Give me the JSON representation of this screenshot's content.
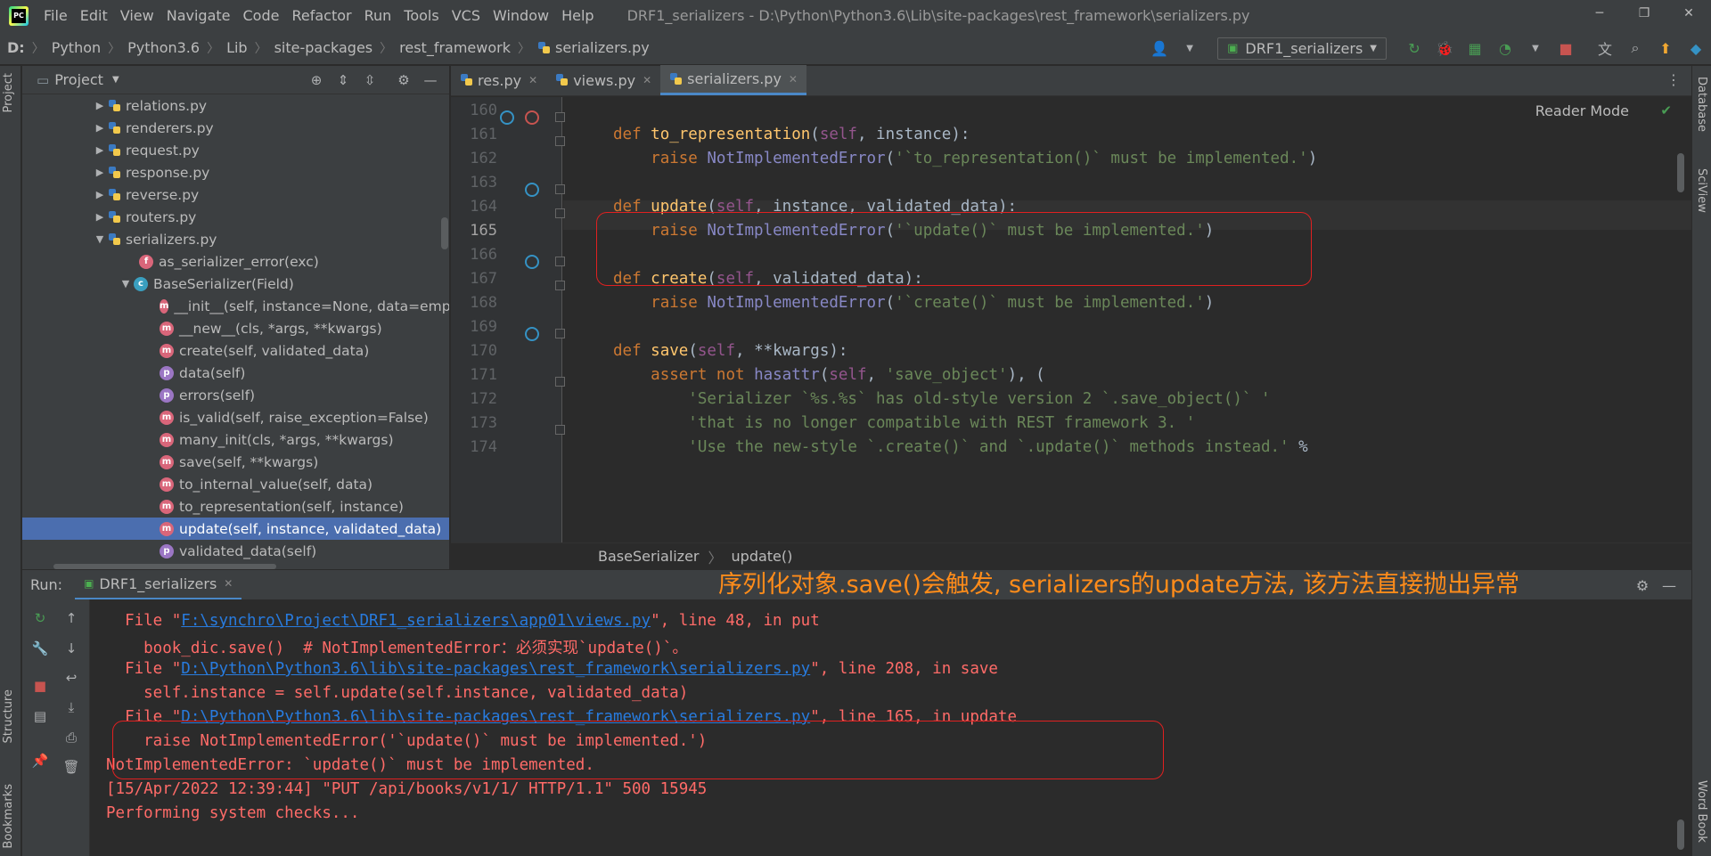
{
  "titlebar": {
    "menus": [
      "File",
      "Edit",
      "View",
      "Navigate",
      "Code",
      "Refactor",
      "Run",
      "Tools",
      "VCS",
      "Window",
      "Help"
    ],
    "title": "DRF1_serializers - D:\\Python\\Python3.6\\Lib\\site-packages\\rest_framework\\serializers.py",
    "minimize": "─",
    "maximize": "❐",
    "close": "✕"
  },
  "navbar": {
    "breadcrumbs": [
      "D:",
      "Python",
      "Python3.6",
      "Lib",
      "site-packages",
      "rest_framework",
      "serializers.py"
    ],
    "run_config": "DRF1_serializers"
  },
  "left_stripe": {
    "project": "Project",
    "structure": "Structure",
    "bookmarks": "Bookmarks"
  },
  "right_stripe": {
    "database": "Database",
    "sciview": "SciView",
    "wordbook": "Word Book"
  },
  "project_panel": {
    "title": "Project",
    "items": [
      {
        "label": "relations.py",
        "kind": "file"
      },
      {
        "label": "renderers.py",
        "kind": "file"
      },
      {
        "label": "request.py",
        "kind": "file"
      },
      {
        "label": "response.py",
        "kind": "file"
      },
      {
        "label": "reverse.py",
        "kind": "file"
      },
      {
        "label": "routers.py",
        "kind": "file"
      },
      {
        "label": "serializers.py",
        "kind": "file-open"
      },
      {
        "label": "as_serializer_error(exc)",
        "kind": "f"
      },
      {
        "label": "BaseSerializer(Field)",
        "kind": "c"
      },
      {
        "label": "__init__(self, instance=None, data=empt",
        "kind": "m"
      },
      {
        "label": "__new__(cls, *args, **kwargs)",
        "kind": "m"
      },
      {
        "label": "create(self, validated_data)",
        "kind": "m"
      },
      {
        "label": "data(self)",
        "kind": "p"
      },
      {
        "label": "errors(self)",
        "kind": "p"
      },
      {
        "label": "is_valid(self, raise_exception=False)",
        "kind": "m"
      },
      {
        "label": "many_init(cls, *args, **kwargs)",
        "kind": "m"
      },
      {
        "label": "save(self, **kwargs)",
        "kind": "m"
      },
      {
        "label": "to_internal_value(self, data)",
        "kind": "m"
      },
      {
        "label": "to_representation(self, instance)",
        "kind": "m"
      },
      {
        "label": "update(self, instance, validated_data)",
        "kind": "m"
      },
      {
        "label": "validated_data(self)",
        "kind": "p"
      }
    ],
    "badge_letters": {
      "f": "f",
      "c": "c",
      "m": "m",
      "p": "p"
    }
  },
  "editor": {
    "tabs": [
      {
        "label": "res.py",
        "active": false
      },
      {
        "label": "views.py",
        "active": false
      },
      {
        "label": "serializers.py",
        "active": true
      }
    ],
    "reader_mode": "Reader Mode",
    "current_line": 165,
    "lines": [
      {
        "n": "160",
        "code": ""
      },
      {
        "n": "161",
        "code": "def to_representation(self, instance):"
      },
      {
        "n": "162",
        "code": "    raise NotImplementedError('`to_representation()` must be implemented.')"
      },
      {
        "n": "163",
        "code": ""
      },
      {
        "n": "164",
        "code": "def update(self, instance, validated_data):"
      },
      {
        "n": "165",
        "code": "    raise NotImplementedError('`update()` must be implemented.')"
      },
      {
        "n": "166",
        "code": ""
      },
      {
        "n": "167",
        "code": "def create(self, validated_data):"
      },
      {
        "n": "168",
        "code": "    raise NotImplementedError('`create()` must be implemented.')"
      },
      {
        "n": "169",
        "code": ""
      },
      {
        "n": "170",
        "code": "def save(self, **kwargs):"
      },
      {
        "n": "171",
        "code": "    assert not hasattr(self, 'save_object'), ("
      },
      {
        "n": "172",
        "code": "        'Serializer `%s.%s` has old-style version 2 `.save_object()` '"
      },
      {
        "n": "173",
        "code": "        'that is no longer compatible with REST framework 3. '"
      },
      {
        "n": "174",
        "code": "        'Use the new-style `.create()` and `.update()` methods instead.' %"
      }
    ],
    "breadcrumb": [
      "BaseSerializer",
      "update()"
    ]
  },
  "run_panel": {
    "label": "Run:",
    "tab": "DRF1_serializers",
    "annotation": "序列化对象.save()会触发, serializers的update方法, 该方法直接抛出异常",
    "console": [
      {
        "pre": "  File \"",
        "link": "F:\\synchro\\Project\\DRF1_serializers\\app01\\views.py",
        "post": "\", line 48, in put"
      },
      {
        "pre": "    book_dic.save()  # NotImplementedError：",
        "cn": "必须实现",
        "post": "`update()`。"
      },
      {
        "pre": "  File \"",
        "link": "D:\\Python\\Python3.6\\lib\\site-packages\\rest_framework\\serializers.py",
        "post": "\", line 208, in save"
      },
      {
        "pre": "    self.instance = self.update(self.instance, validated_data)"
      },
      {
        "pre": "  File \"",
        "link": "D:\\Python\\Python3.6\\lib\\site-packages\\rest_framework\\serializers.py",
        "post": "\", line 165, in update"
      },
      {
        "pre": "    raise NotImplementedError('`update()` must be implemented.')"
      },
      {
        "pre": "NotImplementedError: `update()` must be implemented."
      },
      {
        "pre": "[15/Apr/2022 12:39:44] \"PUT /api/books/v1/1/ HTTP/1.1\" 500 15945"
      },
      {
        "pre": "Performing system checks..."
      }
    ]
  },
  "colors": {
    "keyword": "#cc7832",
    "function": "#ffc66d",
    "self": "#94558d",
    "builtin": "#8888c6",
    "string": "#6a8759",
    "error_text": "#ff6b68",
    "link": "#287bde",
    "annotation": "#ff8c1a",
    "highlight_box": "#e02020",
    "selection": "#4b6eaf"
  }
}
